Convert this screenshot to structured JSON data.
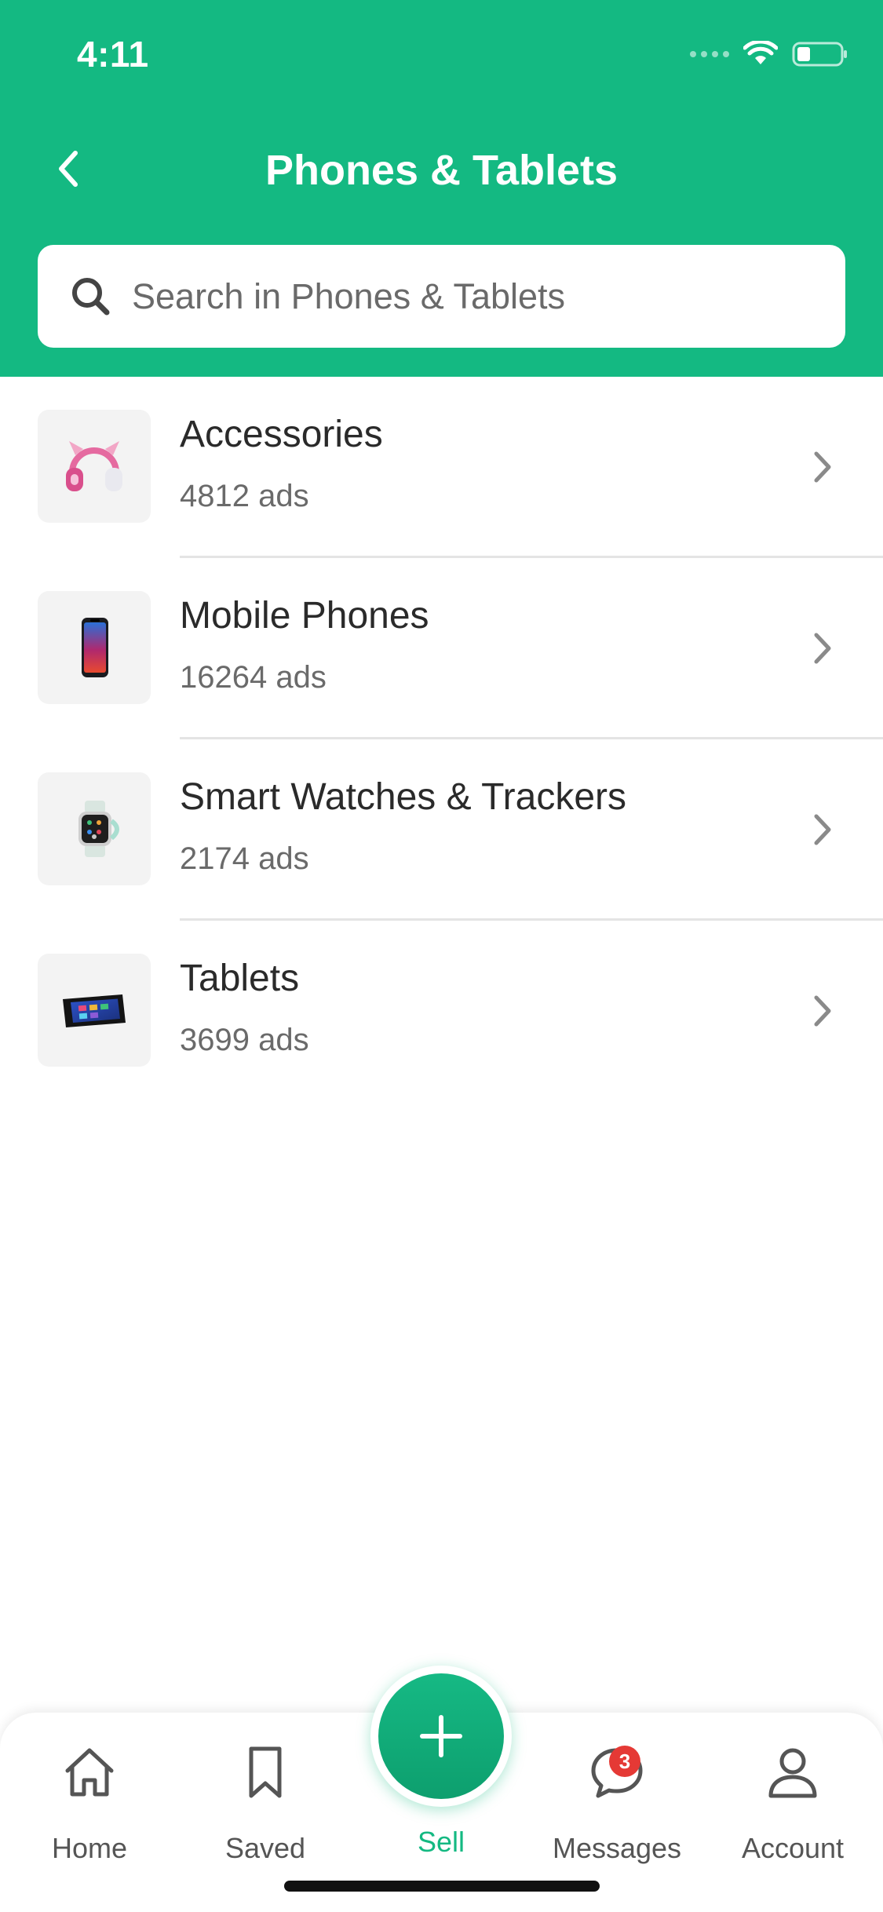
{
  "status_bar": {
    "time": "4:11"
  },
  "header": {
    "title": "Phones & Tablets",
    "search_placeholder": "Search in Phones & Tablets"
  },
  "categories": [
    {
      "name": "Accessories",
      "count": "4812 ads",
      "icon": "headphones-image"
    },
    {
      "name": "Mobile Phones",
      "count": "16264 ads",
      "icon": "smartphone-image"
    },
    {
      "name": "Smart Watches & Trackers",
      "count": "2174 ads",
      "icon": "smartwatch-image"
    },
    {
      "name": "Tablets",
      "count": "3699 ads",
      "icon": "tablet-image"
    }
  ],
  "bottom_nav": {
    "home": "Home",
    "saved": "Saved",
    "sell": "Sell",
    "messages": "Messages",
    "messages_badge": "3",
    "account": "Account"
  },
  "colors": {
    "brand_green": "#14b982",
    "badge_red": "#e53935"
  }
}
